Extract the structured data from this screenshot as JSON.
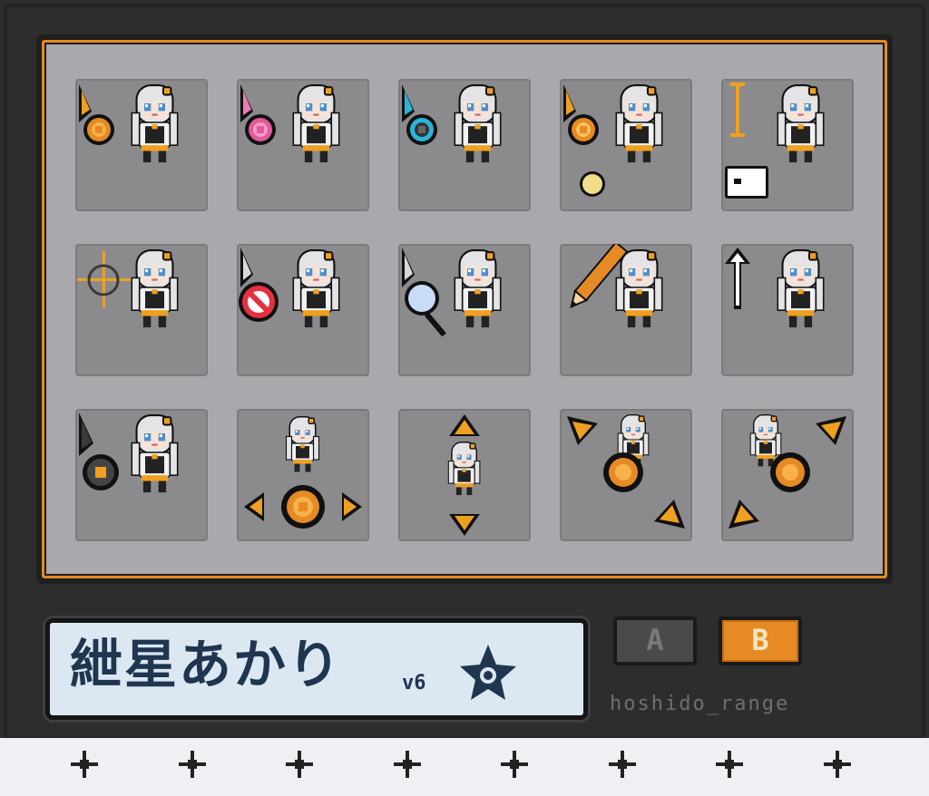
{
  "title": {
    "name": "紲星あかり",
    "version": "v6",
    "badge_icon": "star-flower-icon"
  },
  "buttons": {
    "a_label": "A",
    "b_label": "B"
  },
  "credit": "hoshido_range",
  "colors": {
    "accent": "#e58a24",
    "panel": "#a9a9ad",
    "cell": "#8b8b8d",
    "name_bg": "#dbe8f2",
    "name_text": "#1f3550"
  },
  "cursors": [
    {
      "label": "normal-select",
      "icon": "pointer-orange-icon"
    },
    {
      "label": "help-select",
      "icon": "pointer-pink-icon"
    },
    {
      "label": "working-in-background",
      "icon": "pointer-cyan-icon"
    },
    {
      "label": "busy",
      "icon": "pointer-busy-icon"
    },
    {
      "label": "text-select",
      "icon": "ibeam-icon"
    },
    {
      "label": "precision-select",
      "icon": "crosshair-icon"
    },
    {
      "label": "unavailable",
      "icon": "no-symbol-icon"
    },
    {
      "label": "handwriting",
      "icon": "magnifier-pointer-icon"
    },
    {
      "label": "pen",
      "icon": "pencil-icon"
    },
    {
      "label": "alternate-select",
      "icon": "up-arrow-icon"
    },
    {
      "label": "link-select",
      "icon": "pointer-dark-icon"
    },
    {
      "label": "horizontal-resize",
      "icon": "horizontal-arrows-icon"
    },
    {
      "label": "vertical-resize",
      "icon": "vertical-arrows-icon"
    },
    {
      "label": "diagonal-resize-1",
      "icon": "diagonal-arrows-icon"
    },
    {
      "label": "diagonal-resize-2",
      "icon": "diagonal-arrows-alt-icon"
    }
  ],
  "footer_sparkles": 8
}
